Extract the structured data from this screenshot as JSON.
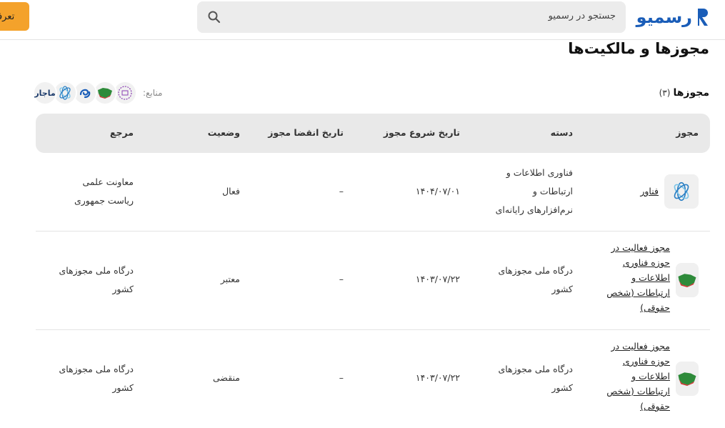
{
  "header": {
    "logo_text": "رسمیو",
    "search_placeholder": "جستجو در رسمیو",
    "cta_label": "تعرفه"
  },
  "page": {
    "title": "مجوزها و مالکیت‌ها"
  },
  "section": {
    "title": "مجوزها",
    "count": "(۳)",
    "sources_label": "منابع:",
    "sources": [
      {
        "icon": "national-license-portal-icon"
      },
      {
        "icon": "iran-map-icon"
      },
      {
        "icon": "enamad-icon"
      },
      {
        "icon": "fanavar-icon"
      },
      {
        "label": "ماجار",
        "icon": "majar-icon"
      }
    ]
  },
  "table": {
    "headers": {
      "license": "مجوز",
      "category": "دسته",
      "start_date": "تاریخ شروع مجوز",
      "expiry_date": "تاریخ انقضا مجوز",
      "status": "وضعیت",
      "authority": "مرجع"
    },
    "rows": [
      {
        "icon": "fanavar-icon",
        "license": "فناور",
        "category": [
          "فناوری اطلاعات و",
          "ارتباطات و",
          "نرم‌افزارهای رایانه‌ای"
        ],
        "start_date": "۱۴۰۴/۰۷/۰۱",
        "expiry_date": "–",
        "status": "فعال",
        "authority": [
          "معاونت علمی",
          "ریاست جمهوری"
        ]
      },
      {
        "icon": "iran-map-icon",
        "license": [
          "مجوز فعالیت در",
          "حوزه فناوری",
          "اطلاعات و",
          "ارتباطات (شخص",
          "حقوقی)"
        ],
        "category": [
          "درگاه ملی مجوزهای",
          "کشور"
        ],
        "start_date": "۱۴۰۳/۰۷/۲۲",
        "expiry_date": "–",
        "status": "معتبر",
        "authority": [
          "درگاه ملی مجوزهای",
          "کشور"
        ]
      },
      {
        "icon": "iran-map-icon",
        "license": [
          "مجوز فعالیت در",
          "حوزه فناوری",
          "اطلاعات و",
          "ارتباطات (شخص",
          "حقوقی)"
        ],
        "category": [
          "درگاه ملی مجوزهای",
          "کشور"
        ],
        "start_date": "۱۴۰۳/۰۷/۲۲",
        "expiry_date": "–",
        "status": "منقضی",
        "authority": [
          "درگاه ملی مجوزهای",
          "کشور"
        ]
      }
    ]
  },
  "colors": {
    "brand": "#1a5db8",
    "cta": "#f4a22b",
    "table_header_bg": "#e9e9e9",
    "search_bg": "#ececec"
  }
}
